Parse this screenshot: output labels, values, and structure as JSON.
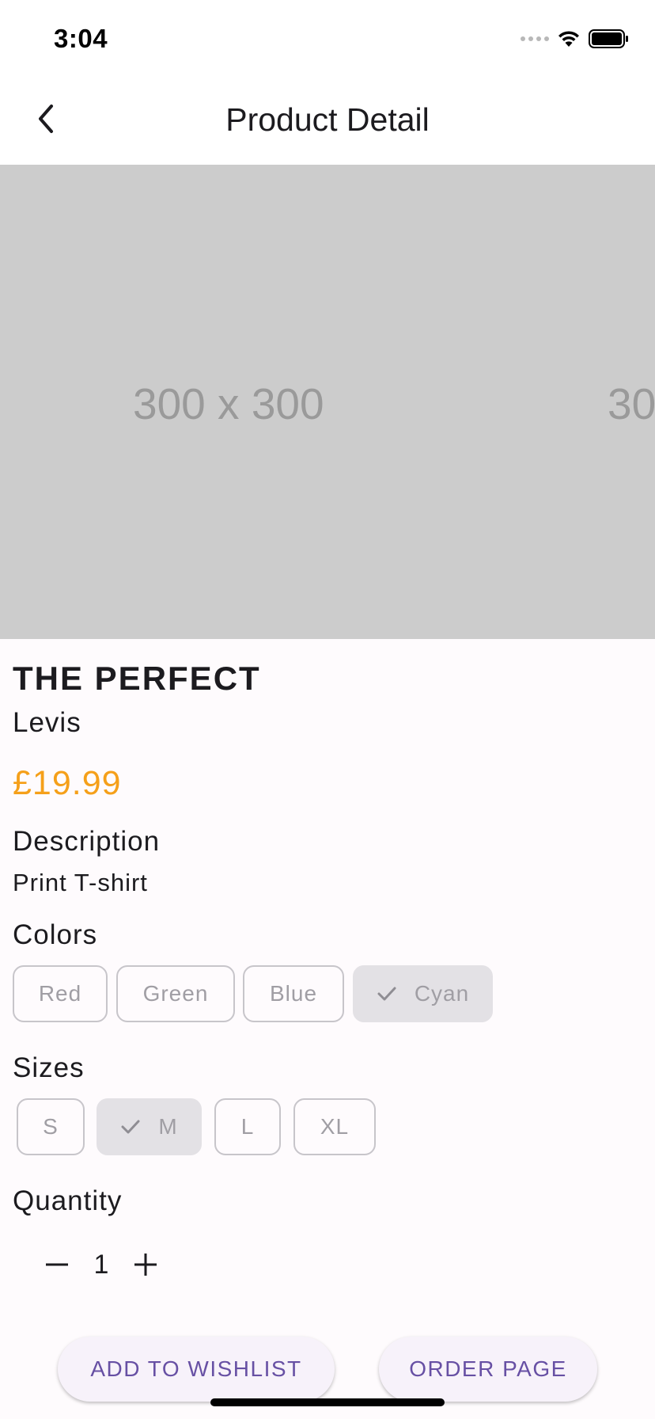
{
  "status_bar": {
    "time": "3:04"
  },
  "app_bar": {
    "title": "Product Detail"
  },
  "gallery": {
    "images": [
      "300 x 300",
      "300 x 300"
    ]
  },
  "product": {
    "name": "THE PERFECT",
    "brand": "Levis",
    "price": "£19.99",
    "price_color": "#f5a01a"
  },
  "description": {
    "label": "Description",
    "text": "Print T-shirt"
  },
  "colors": {
    "label": "Colors",
    "options": [
      "Red",
      "Green",
      "Blue",
      "Cyan"
    ],
    "selected": "Cyan"
  },
  "sizes": {
    "label": "Sizes",
    "options": [
      "S",
      "M",
      "L",
      "XL"
    ],
    "selected": "M"
  },
  "quantity": {
    "label": "Quantity",
    "value": "1"
  },
  "actions": {
    "wishlist_label": "ADD TO WISHLIST",
    "order_label": "ORDER PAGE"
  },
  "icons": {
    "back": "back-arrow-icon",
    "check": "check-icon",
    "minus": "minus-icon",
    "plus": "plus-icon",
    "wifi": "wifi-icon",
    "battery": "battery-icon"
  },
  "theme": {
    "accent": "#6750a4",
    "chip_selected_bg": "#e3e1e5",
    "placeholder_bg": "#cccccc"
  }
}
